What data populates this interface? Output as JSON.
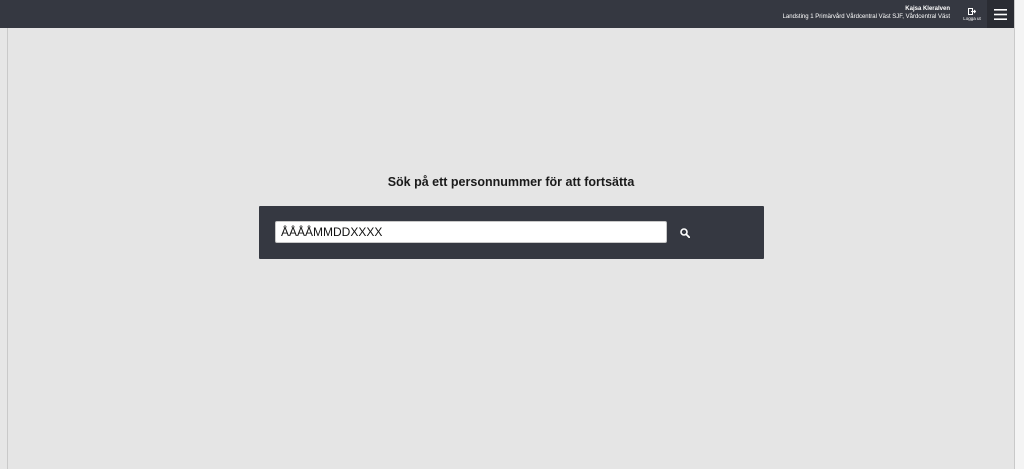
{
  "header": {
    "user_name": "Kajsa Kleralven",
    "unit": "Landsting 1 Primärvård Vårdcentral Väst SJF, Vårdcentral Väst",
    "logout_label": "Logga ut",
    "menu_icon": "hamburger-icon",
    "logout_icon": "logout-icon"
  },
  "search": {
    "title": "Sök på ett personnummer för att fortsätta",
    "placeholder": "ÅÅÅÅMMDDXXXX",
    "button_icon": "search-icon"
  },
  "colors": {
    "topbar": "#353841",
    "panel": "#353841",
    "background": "#e5e5e5"
  }
}
